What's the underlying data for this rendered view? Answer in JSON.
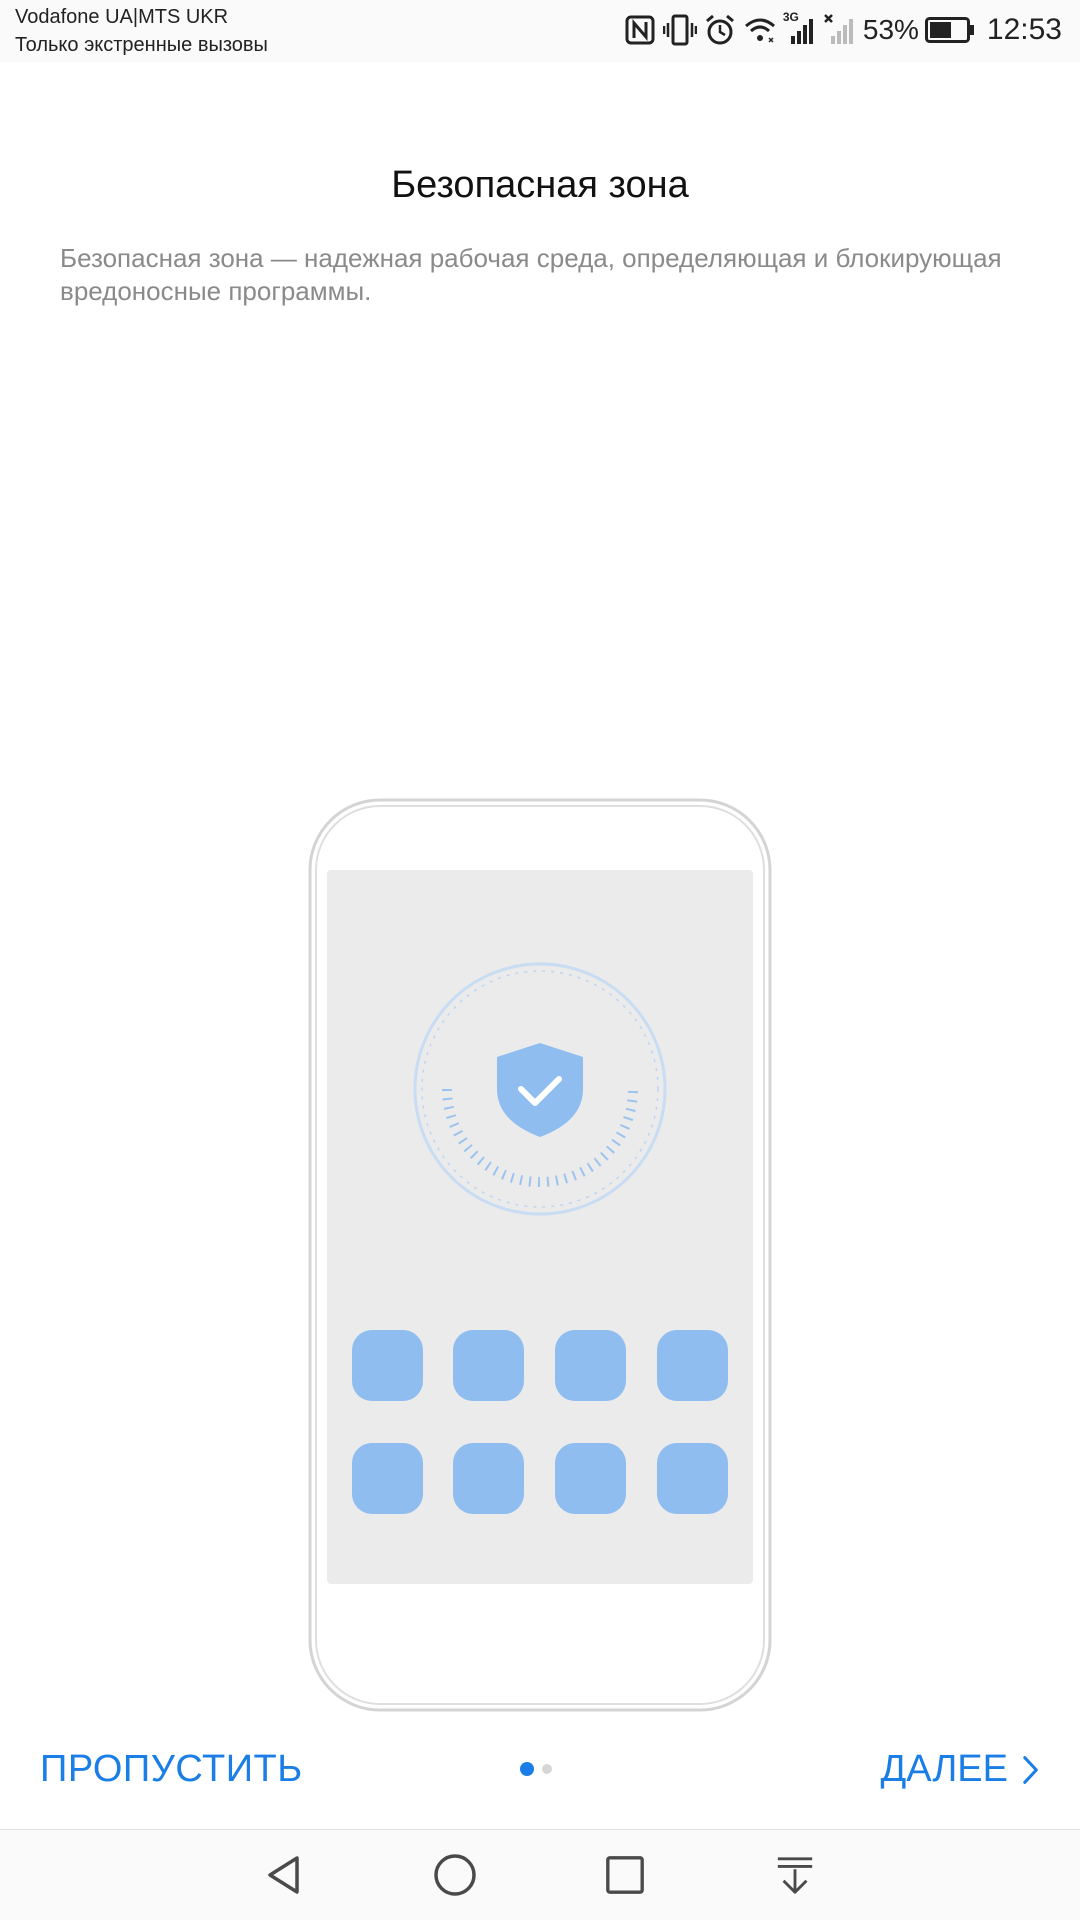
{
  "status_bar": {
    "carrier": "Vodafone UA|MTS UKR",
    "emergency": "Только экстренные вызовы",
    "network": "3G",
    "battery": "53%",
    "time": "12:53"
  },
  "page": {
    "title": "Безопасная зона",
    "description": "Безопасная зона — надежная рабочая среда, определяющая и блокирующая вредоносные программы."
  },
  "footer": {
    "skip_label": "ПРОПУСТИТЬ",
    "next_label": "ДАЛЕЕ",
    "pages_total": 2,
    "page_current": 1
  },
  "colors": {
    "accent": "#1a7ee6",
    "illustration_blue": "#8fbdf0",
    "screen_gray": "#ebebeb"
  },
  "icons": {
    "status": [
      "nfc-icon",
      "vibrate-icon",
      "alarm-icon",
      "wifi-icon",
      "signal-icon",
      "no-signal-icon",
      "battery-icon"
    ],
    "nav": [
      "back-icon",
      "home-icon",
      "recents-icon",
      "notifications-pull-icon"
    ]
  }
}
